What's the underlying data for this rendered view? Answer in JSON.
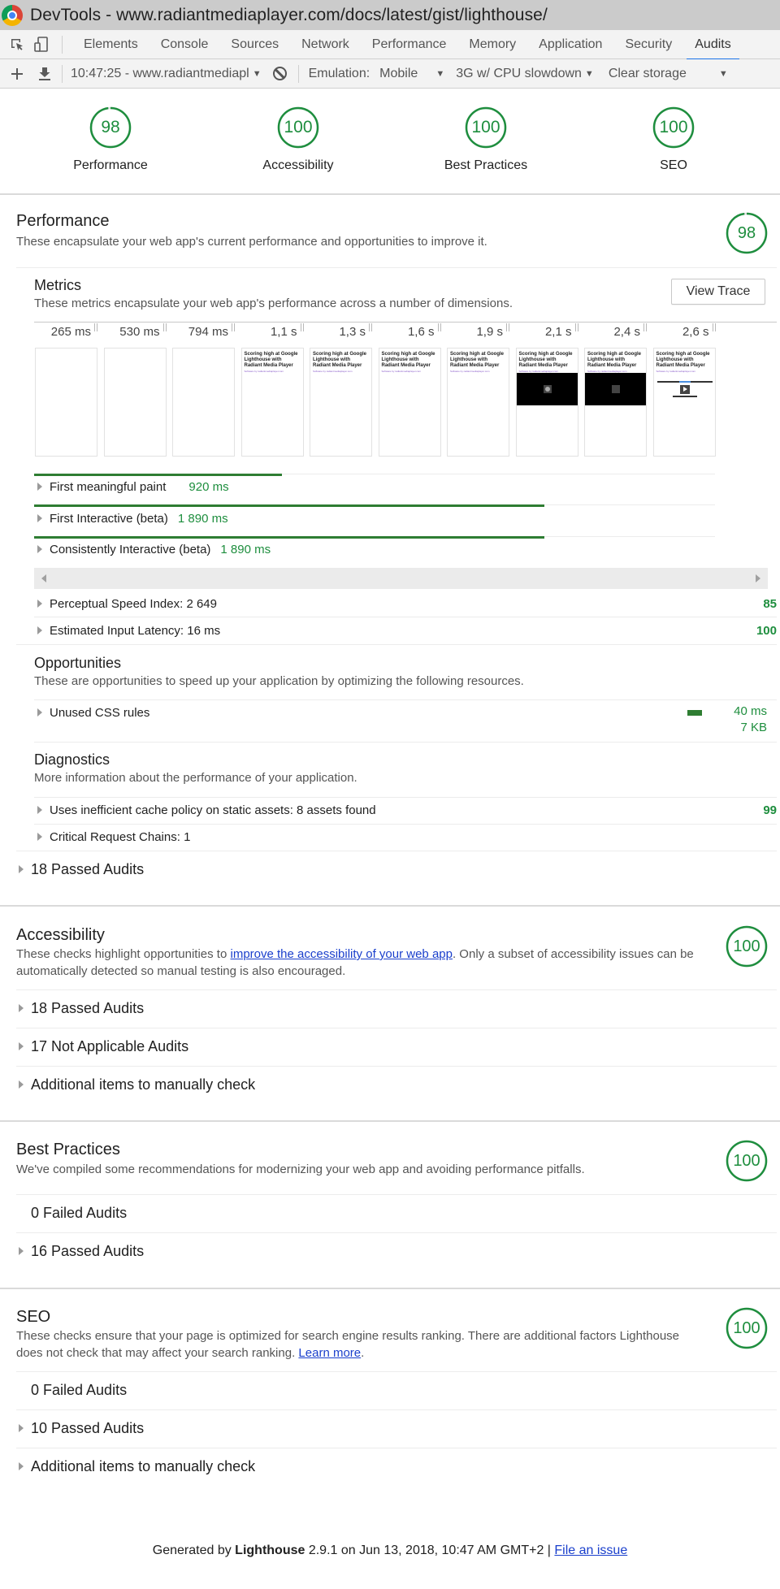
{
  "window": {
    "title": "DevTools - www.radiantmediaplayer.com/docs/latest/gist/lighthouse/"
  },
  "tabs": [
    {
      "label": "Elements"
    },
    {
      "label": "Console"
    },
    {
      "label": "Sources"
    },
    {
      "label": "Network"
    },
    {
      "label": "Performance"
    },
    {
      "label": "Memory"
    },
    {
      "label": "Application"
    },
    {
      "label": "Security"
    },
    {
      "label": "Audits",
      "active": true
    }
  ],
  "toolbar": {
    "report_select": "10:47:25 - www.radiantmediapl",
    "emulation_label": "Emulation:",
    "emulation_value": "Mobile",
    "throttling_value": "3G w/ CPU slowdown",
    "clear_storage_label": "Clear storage"
  },
  "colors": {
    "pass": "#1e8e3e",
    "bar": "#2e7d32",
    "link": "#1a3fcc",
    "active_tab": "#1a73e8"
  },
  "summary": [
    {
      "label": "Performance",
      "score": "98",
      "value": 98
    },
    {
      "label": "Accessibility",
      "score": "100",
      "value": 100
    },
    {
      "label": "Best Practices",
      "score": "100",
      "value": 100
    },
    {
      "label": "SEO",
      "score": "100",
      "value": 100
    }
  ],
  "performance": {
    "title": "Performance",
    "description": "These encapsulate your web app's current performance and opportunities to improve it.",
    "score": "98",
    "metrics": {
      "title": "Metrics",
      "description": "These metrics encapsulate your web app's performance across a number of dimensions.",
      "view_trace_label": "View Trace",
      "timeline": [
        "265 ms",
        "530 ms",
        "794 ms",
        "1,1 s",
        "1,3 s",
        "1,6 s",
        "1,9 s",
        "2,1 s",
        "2,4 s",
        "2,6 s"
      ],
      "frames": [
        {
          "state": "blank"
        },
        {
          "state": "blank"
        },
        {
          "state": "blank"
        },
        {
          "state": "text"
        },
        {
          "state": "text"
        },
        {
          "state": "text"
        },
        {
          "state": "text"
        },
        {
          "state": "video-loading"
        },
        {
          "state": "video-black"
        },
        {
          "state": "player"
        }
      ],
      "frame_heading": "Scoring high at Google Lighthouse with Radiant Media Player",
      "frame_subtitle": "Software by radiantmediaplayer.com",
      "items": [
        {
          "label": "First meaningful paint",
          "value": "920 ms",
          "ms": 920
        },
        {
          "label": "First Interactive (beta)",
          "value": "1 890 ms",
          "ms": 1890
        },
        {
          "label": "Consistently Interactive (beta)",
          "value": "1 890 ms",
          "ms": 1890
        }
      ],
      "timeline_max_ms": 2650,
      "scored": [
        {
          "label": "Perceptual Speed Index: 2 649",
          "score": "85"
        },
        {
          "label": "Estimated Input Latency: 16 ms",
          "score": "100"
        }
      ]
    },
    "opportunities": {
      "title": "Opportunities",
      "description": "These are opportunities to speed up your application by optimizing the following resources.",
      "items": [
        {
          "label": "Unused CSS rules",
          "time": "40 ms",
          "size": "7 KB"
        }
      ]
    },
    "diagnostics": {
      "title": "Diagnostics",
      "description": "More information about the performance of your application.",
      "items": [
        {
          "label": "Uses inefficient cache policy on static assets: 8 assets found",
          "score": "99"
        },
        {
          "label": "Critical Request Chains: 1",
          "score": ""
        }
      ]
    },
    "passed": "18 Passed Audits"
  },
  "accessibility": {
    "title": "Accessibility",
    "description_before": "These checks highlight opportunities to ",
    "description_link": "improve the accessibility of your web app",
    "description_after": ". Only a subset of accessibility issues can be automatically detected so manual testing is also encouraged.",
    "score": "100",
    "groups": [
      "18 Passed Audits",
      "17 Not Applicable Audits",
      "Additional items to manually check"
    ]
  },
  "best_practices": {
    "title": "Best Practices",
    "description": "We've compiled some recommendations for modernizing your web app and avoiding performance pitfalls.",
    "score": "100",
    "failed": "0 Failed Audits",
    "passed": "16 Passed Audits"
  },
  "seo": {
    "title": "SEO",
    "description_before": "These checks ensure that your page is optimized for search engine results ranking. There are additional factors Lighthouse does not check that may affect your search ranking. ",
    "description_link": "Learn more",
    "description_after": ".",
    "score": "100",
    "failed": "0 Failed Audits",
    "groups": [
      "10 Passed Audits",
      "Additional items to manually check"
    ]
  },
  "footer": {
    "prefix": "Generated by ",
    "product": "Lighthouse",
    "suffix": " 2.9.1 on Jun 13, 2018, 10:47 AM GMT+2 | ",
    "link": "File an issue"
  }
}
